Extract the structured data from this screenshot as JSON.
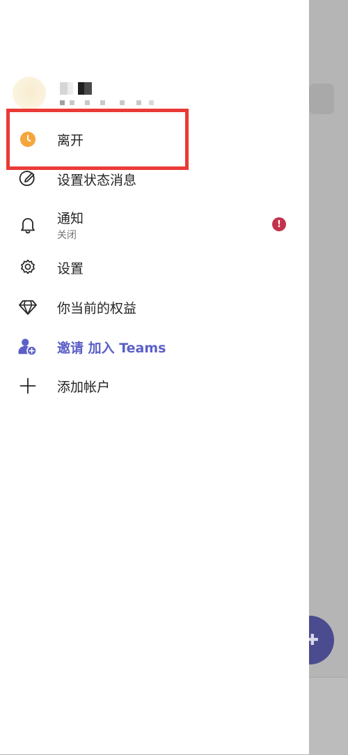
{
  "menu": {
    "away": {
      "label": "离开",
      "icon": "clock-icon",
      "status_color": "#f4a53c"
    },
    "set_status": {
      "label": "设置状态消息",
      "icon": "edit-status-icon"
    },
    "notifications": {
      "label": "通知",
      "sublabel": "关闭",
      "icon": "bell-icon",
      "badge": "!",
      "badge_color": "#c4314b"
    },
    "settings": {
      "label": "设置",
      "icon": "gear-icon"
    },
    "benefits": {
      "label": "你当前的权益",
      "icon": "diamond-icon"
    },
    "invite": {
      "label": "邀请 加入 Teams",
      "icon": "add-person-icon",
      "accent_color": "#5b5fc7"
    },
    "add_account": {
      "label": "添加帐户",
      "icon": "plus-icon"
    }
  },
  "fab": {
    "icon": "new-chat-plus-icon",
    "color": "#4b4c8f"
  },
  "highlight_color": "#ea3a36"
}
